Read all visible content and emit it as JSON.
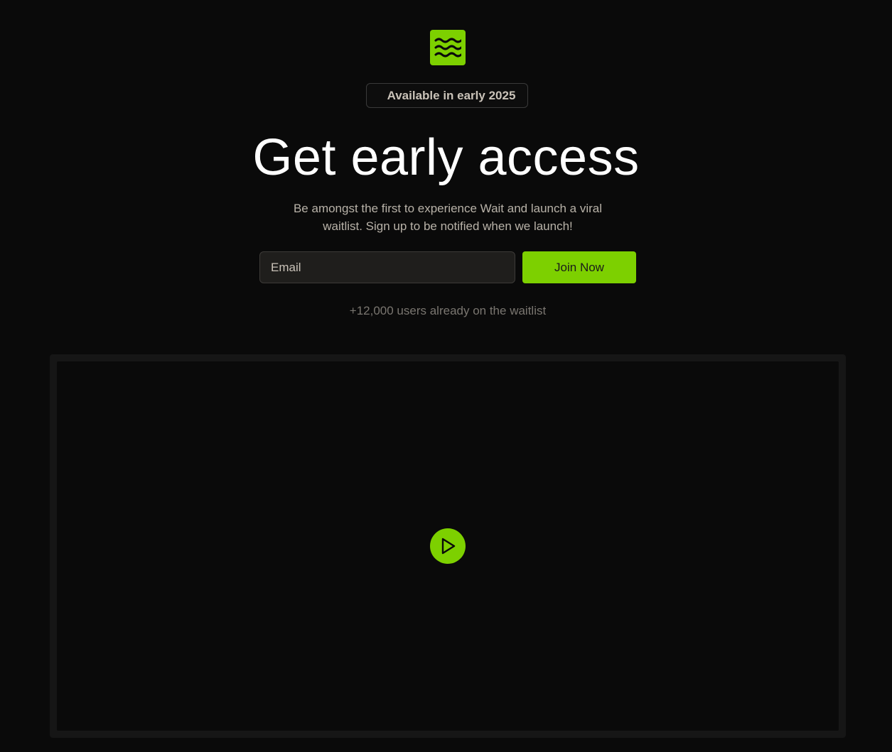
{
  "brand": {
    "logo_icon": "waves-icon",
    "accent_color": "#7dd000"
  },
  "badge": {
    "label": "Available in early 2025"
  },
  "hero": {
    "title": "Get early access",
    "subtitle": "Be amongst the first to experience Wait and launch a viral waitlist. Sign up to be notified when we launch!"
  },
  "signup": {
    "email_placeholder": "Email",
    "email_value": "",
    "button_label": "Join Now"
  },
  "social_proof": {
    "text": "+12,000 users already on the waitlist"
  },
  "video": {
    "play_icon": "play-icon"
  }
}
